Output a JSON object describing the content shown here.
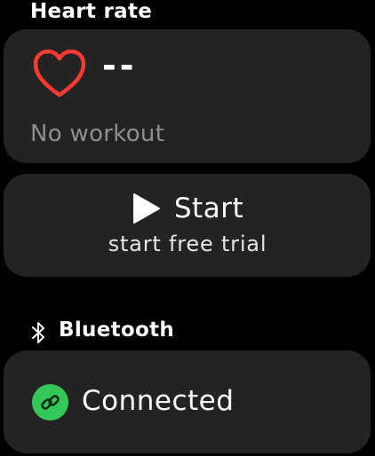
{
  "heart_rate": {
    "section_title": "Heart rate",
    "value": "--",
    "status": "No workout",
    "icon": "heart-outline-icon",
    "icon_color": "#ff3b30"
  },
  "workout": {
    "start_label": "Start",
    "subtitle": "start free trial",
    "icon": "play-icon"
  },
  "bluetooth": {
    "section_title": "Bluetooth",
    "status": "Connected",
    "icon": "bluetooth-icon",
    "status_icon": "link-icon",
    "status_color": "#34c759"
  },
  "colors": {
    "background": "#000000",
    "card": "#232323",
    "secondary_text": "#8e8e93"
  }
}
